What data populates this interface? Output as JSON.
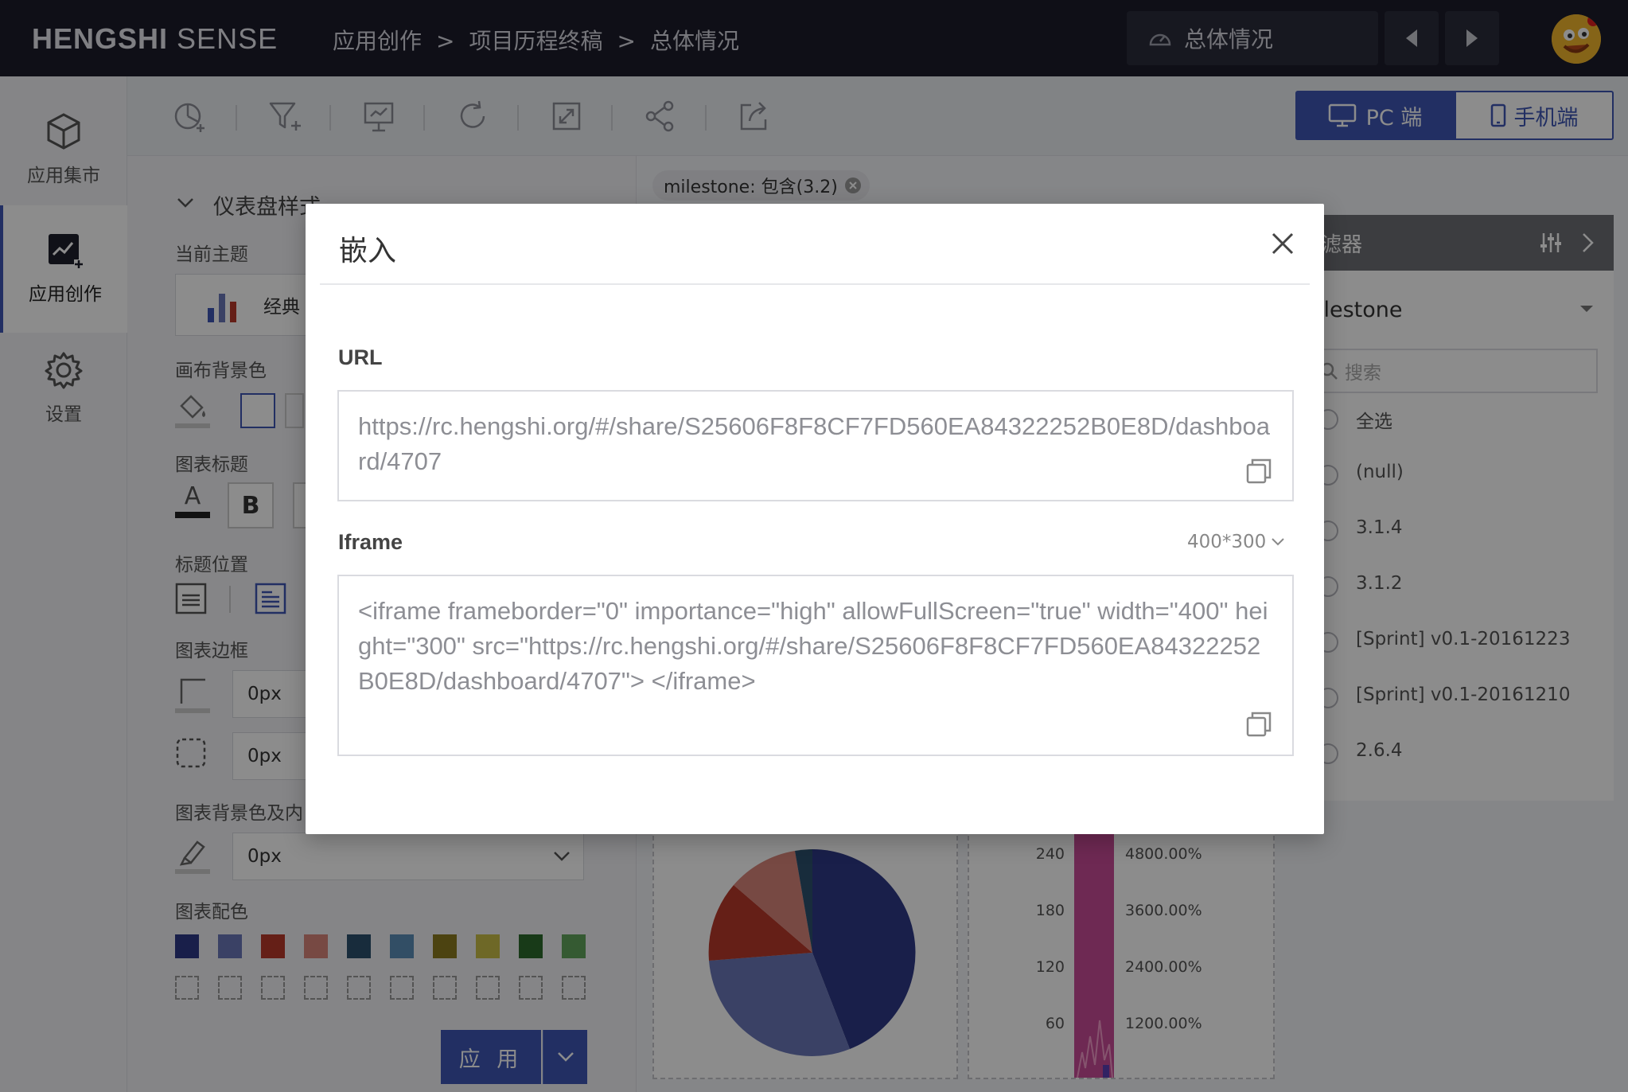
{
  "app": {
    "brand_bold": "HENGSHI",
    "brand_light": "SENSE"
  },
  "breadcrumb": [
    "应用创作",
    "项目历程终稿",
    "总体情况"
  ],
  "breadcrumb_sep": ">",
  "dashboard_select": {
    "label": "总体情况",
    "icon": "gauge-icon"
  },
  "leftnav": [
    {
      "label": "应用集市",
      "icon": "cube-icon"
    },
    {
      "label": "应用创作",
      "icon": "chart-create-icon",
      "active": true
    },
    {
      "label": "设置",
      "icon": "gear-icon"
    }
  ],
  "view_switch": {
    "pc": "PC 端",
    "mobile": "手机端"
  },
  "style_panel": {
    "section_title": "仪表盘样式",
    "current_theme_label": "当前主题",
    "theme_value": "经典",
    "canvas_bg_label": "画布背景色",
    "chart_title_label": "图表标题",
    "bold_label": "B",
    "text_label": "A",
    "title_position_label": "标题位置",
    "chart_border_label": "图表边框",
    "border_width": "0px",
    "border_radius": "0px",
    "chart_bg_label": "图表背景色及内",
    "chart_padding": "0px",
    "chart_palette_label": "图表配色",
    "palette": [
      "#2e3a87",
      "#6a77b8",
      "#b8392b",
      "#d9867a",
      "#2d506e",
      "#5b8fb8",
      "#8a7a1f",
      "#c8bd48",
      "#2d6b2c",
      "#62a55c"
    ],
    "apply_label": "应 用"
  },
  "filter_chip": "milestone: 包含(3.2)",
  "filter_panel": {
    "title": "滤器",
    "field": "ilestone",
    "search_placeholder": "搜索",
    "options": [
      "全选",
      "(null)",
      "3.1.4",
      "3.1.2",
      "[Sprint] v0.1-20161223",
      "[Sprint] v0.1-20161210",
      "2.6.4"
    ]
  },
  "bg_chart": {
    "left_ticks": [
      "240",
      "180",
      "120",
      "60"
    ],
    "right_ticks": [
      "4800.00%",
      "3600.00%",
      "2400.00%",
      "1200.00%"
    ]
  },
  "modal": {
    "title": "嵌入",
    "url_label": "URL",
    "url_value": "https://rc.hengshi.org/#/share/S25606F8F8CF7FD560EA84322252B0E8D/dashboard/4707",
    "iframe_label": "Iframe",
    "iframe_size": "400*300",
    "iframe_value": "<iframe frameborder=\"0\" importance=\"high\" allowFullScreen=\"true\" width=\"400\" height=\"300\" src=\"https://rc.hengshi.org/#/share/S25606F8F8CF7FD560EA84322252B0E8D/dashboard/4707\"> </iframe>"
  }
}
